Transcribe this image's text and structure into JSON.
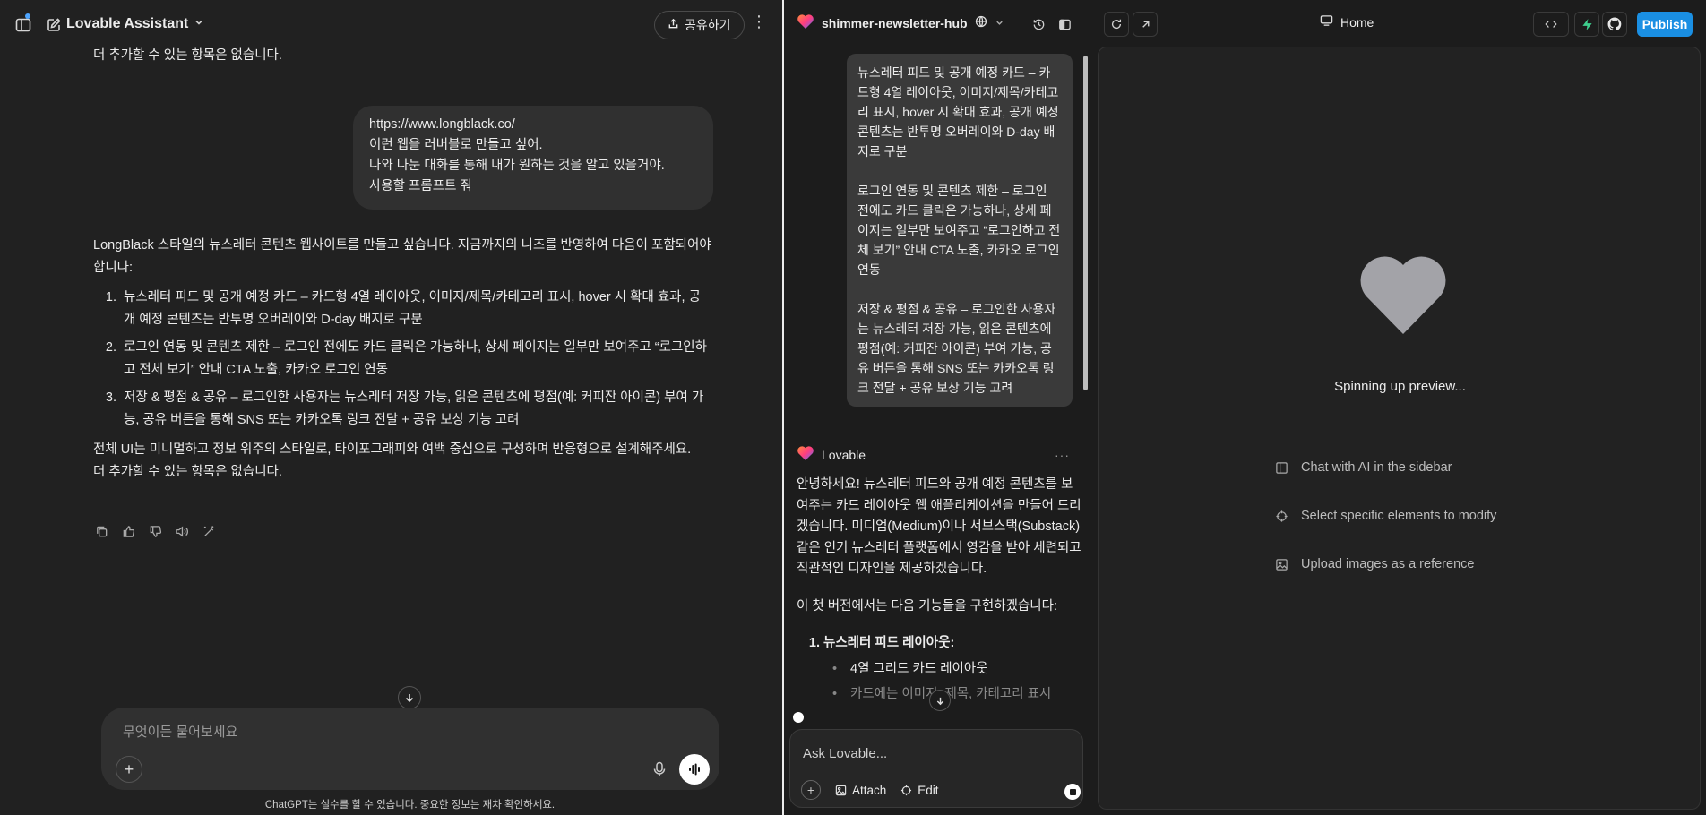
{
  "left": {
    "title": "Lovable Assistant",
    "share_label": "공유하기",
    "prev_tail": "더 추가할 수 있는 항목은 없습니다.",
    "user_message": [
      "https://www.longblack.co/",
      "이런 웹을 러버블로 만들고 싶어.",
      "나와 나눈 대화를 통해 내가 원하는 것을 알고 있을거야.",
      "사용할 프롬프트 줘"
    ],
    "answer_intro": "LongBlack 스타일의 뉴스레터 콘텐츠 웹사이트를 만들고 싶습니다. 지금까지의 니즈를 반영하여 다음이 포함되어야 합니다:",
    "answer_items": [
      "뉴스레터 피드 및 공개 예정 카드 – 카드형 4열 레이아웃, 이미지/제목/카테고리 표시, hover 시 확대 효과, 공개 예정 콘텐츠는 반투명 오버레이와 D-day 배지로 구분",
      "로그인 연동 및 콘텐츠 제한 – 로그인 전에도 카드 클릭은 가능하나, 상세 페이지는 일부만 보여주고 “로그인하고 전체 보기” 안내 CTA 노출, 카카오 로그인 연동",
      "저장 & 평점 & 공유 – 로그인한 사용자는 뉴스레터 저장 가능, 읽은 콘텐츠에 평점(예: 커피잔 아이콘) 부여 가능, 공유 버튼을 통해 SNS 또는 카카오톡 링크 전달 + 공유 보상 기능 고려"
    ],
    "answer_outro": "전체 UI는 미니멀하고 정보 위주의 스타일로, 타이포그래피와 여백 중심으로 구성하며 반응형으로 설계해주세요.",
    "answer_tail": "더 추가할 수 있는 항목은 없습니다.",
    "composer_placeholder": "무엇이든 물어보세요",
    "disclaimer": "ChatGPT는 실수를 할 수 있습니다. 중요한 정보는 재차 확인하세요."
  },
  "right": {
    "project_name": "shimmer-newsletter-hub",
    "home_label": "Home",
    "publish_label": "Publish",
    "user_bubble": [
      "뉴스레터 피드 및 공개 예정 카드 – 카드형 4열 레이아웃, 이미지/제목/카테고리 표시, hover 시 확대 효과, 공개 예정 콘텐츠는 반투명 오버레이와 D-day 배지로 구분",
      "로그인 연동 및 콘텐츠 제한 – 로그인 전에도 카드 클릭은 가능하나, 상세 페이지는 일부만 보여주고 “로그인하고 전체 보기” 안내 CTA 노출, 카카오 로그인 연동",
      "저장 & 평점 & 공유 – 로그인한 사용자는 뉴스레터 저장 가능, 읽은 콘텐츠에 평점(예: 커피잔 아이콘) 부여 가능, 공유 버튼을 통해 SNS 또는 카카오톡 링크 전달 + 공유 보상 기능 고려"
    ],
    "assistant_name": "Lovable",
    "assistant_p1": "안녕하세요! 뉴스레터 피드와 공개 예정 콘텐츠를 보여주는 카드 레이아웃 웹 애플리케이션을 만들어 드리겠습니다. 미디엄(Medium)이나 서브스택(Substack) 같은 인기 뉴스레터 플랫폼에서 영감을 받아 세련되고 직관적인 디자인을 제공하겠습니다.",
    "assistant_p2": "이 첫 버전에서는 다음 기능들을 구현하겠습니다:",
    "feature_1_title": "뉴스레터 피드 레이아웃",
    "feature_1_colon": ":",
    "feature_1_subitems": [
      "4열 그리드 카드 레이아웃",
      "카드에는 이미지, 제목, 카테고리 표시"
    ],
    "composer_placeholder": "Ask Lovable...",
    "attach_label": "Attach",
    "edit_label": "Edit",
    "preview_status": "Spinning up preview...",
    "tips": [
      {
        "icon": "sidebar-icon",
        "label": "Chat with AI in the sidebar"
      },
      {
        "icon": "crosshair-icon",
        "label": "Select specific elements to modify"
      },
      {
        "icon": "image-icon",
        "label": "Upload images as a reference"
      }
    ]
  },
  "colors": {
    "left_bg": "#212121",
    "right_bg": "#1c1c1c",
    "publish": "#1a8fe3",
    "heart": "#a3a3a8"
  }
}
